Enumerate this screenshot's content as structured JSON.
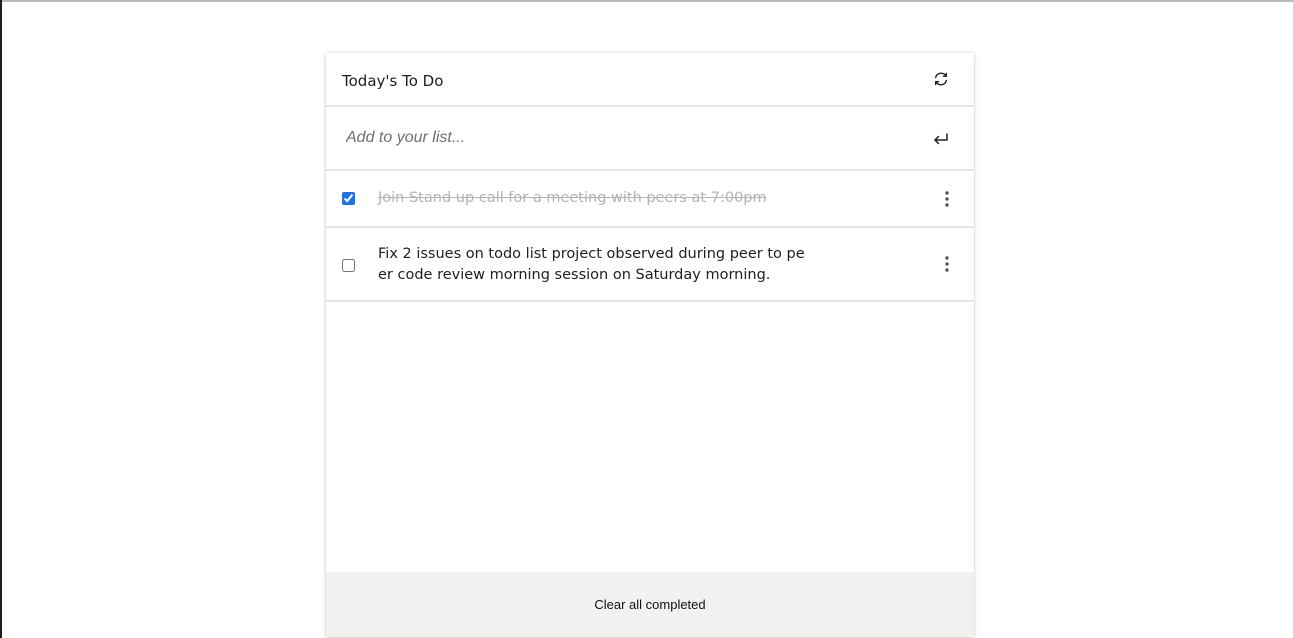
{
  "app": {
    "title": "Today's To Do"
  },
  "header": {
    "refresh_icon": "refresh-icon"
  },
  "add": {
    "placeholder": "Add to your list...",
    "value": "",
    "enter_icon": "enter-icon"
  },
  "todos": [
    {
      "text": "Join Stand up call for a meeting with peers at 7:00pm",
      "completed": true,
      "menu_icon": "more-vertical-icon"
    },
    {
      "text": "Fix 2 issues on todo list project observed during peer to peer code review morning session on Saturday morning.",
      "completed": false,
      "menu_icon": "more-vertical-icon"
    }
  ],
  "footer": {
    "clear_label": "Clear all completed"
  },
  "colors": {
    "accent": "#1a73e8",
    "completed_text": "#b3b3b3",
    "footer_bg": "#f2f1f0",
    "divider": "#e6e6e6"
  }
}
